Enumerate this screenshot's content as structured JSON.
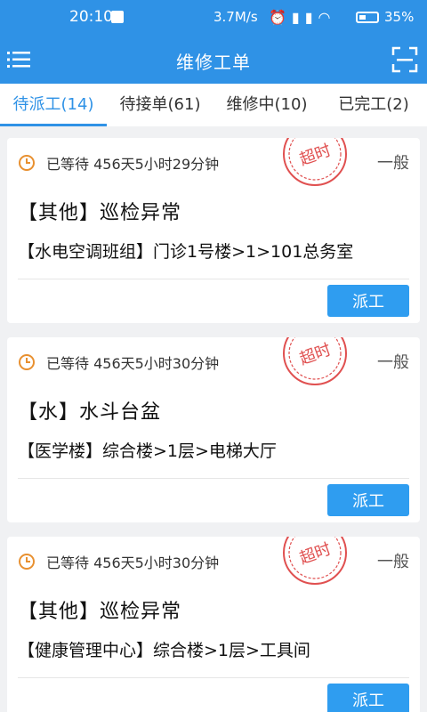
{
  "status": {
    "time": "20:10",
    "net": "3.7M/s",
    "battery": "35%"
  },
  "header": {
    "title": "维修工单"
  },
  "tabs": [
    {
      "label": "待派工(14)",
      "active": true
    },
    {
      "label": "待接单(61)",
      "active": false
    },
    {
      "label": "维修中(10)",
      "active": false
    },
    {
      "label": "已完工(2)",
      "active": false
    }
  ],
  "stamp_text": "超时",
  "orders": [
    {
      "wait": "已等待 456天5小时29分钟",
      "level": "一般",
      "category": "【其他】巡检异常",
      "location": "【水电空调班组】门诊1号楼>1>101总务室",
      "action": "派工"
    },
    {
      "wait": "已等待 456天5小时30分钟",
      "level": "一般",
      "category": "【水】水斗台盆",
      "location": "【医学楼】综合楼>1层>电梯大厅",
      "action": "派工"
    },
    {
      "wait": "已等待 456天5小时30分钟",
      "level": "一般",
      "category": "【其他】巡检异常",
      "location": "【健康管理中心】综合楼>1层>工具间",
      "action": "派工"
    }
  ],
  "colors": {
    "primary": "#2f92e6",
    "stamp": "#e05050",
    "clock": "#e89030"
  }
}
